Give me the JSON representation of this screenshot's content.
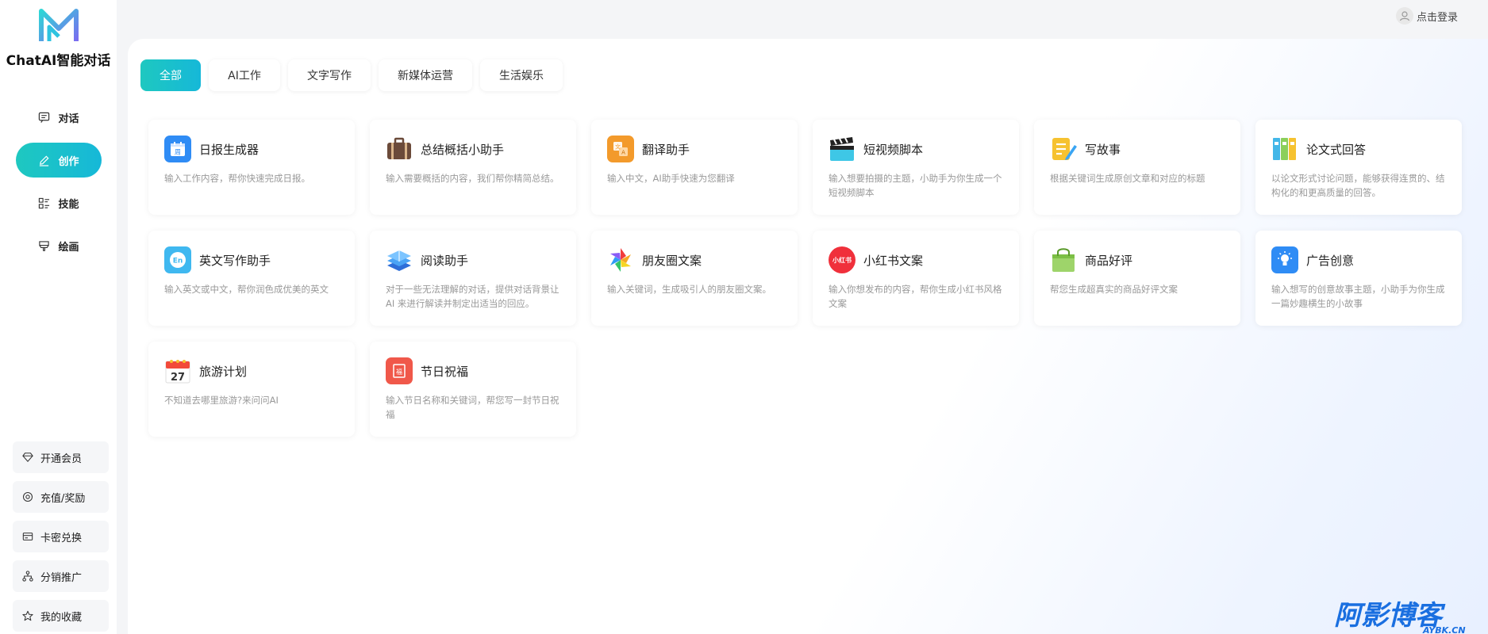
{
  "app": {
    "title": "ChatAI智能对话"
  },
  "nav": [
    {
      "label": "对话",
      "icon": "chat-icon",
      "active": false
    },
    {
      "label": "创作",
      "icon": "pen-icon",
      "active": true
    },
    {
      "label": "技能",
      "icon": "grid-list-icon",
      "active": false
    },
    {
      "label": "绘画",
      "icon": "brush-icon",
      "active": false
    }
  ],
  "bottom_menu": [
    {
      "label": "开通会员",
      "icon": "diamond-icon"
    },
    {
      "label": "充值/奖励",
      "icon": "coin-icon"
    },
    {
      "label": "卡密兑换",
      "icon": "card-icon"
    },
    {
      "label": "分销推广",
      "icon": "share-tree-icon"
    },
    {
      "label": "我的收藏",
      "icon": "star-icon"
    }
  ],
  "header": {
    "login_label": "点击登录"
  },
  "tabs": [
    "全部",
    "AI工作",
    "文字写作",
    "新媒体运营",
    "生活娱乐"
  ],
  "cards": [
    {
      "title": "日报生成器",
      "desc": "输入工作内容，帮你快速完成日报。",
      "icon": "calendar-week-icon"
    },
    {
      "title": "总结概括小助手",
      "desc": "输入需要概括的内容，我们帮你精简总结。",
      "icon": "briefcase-icon"
    },
    {
      "title": "翻译助手",
      "desc": "输入中文，AI助手快速为您翻译",
      "icon": "translate-icon"
    },
    {
      "title": "短视频脚本",
      "desc": "输入想要拍摄的主题，小助手为你生成一个短视频脚本",
      "icon": "clapperboard-icon"
    },
    {
      "title": "写故事",
      "desc": "根据关键词生成原创文章和对应的标题",
      "icon": "notepad-pencil-icon"
    },
    {
      "title": "论文式回答",
      "desc": "以论文形式讨论问题，能够获得连贯的、结构化的和更高质量的回答。",
      "icon": "binders-icon"
    },
    {
      "title": "英文写作助手",
      "desc": "输入英文或中文，帮你润色成优美的英文",
      "icon": "english-badge-icon"
    },
    {
      "title": "阅读助手",
      "desc": "对于一些无法理解的对话，提供对话背景让 AI 来进行解读并制定出适当的回应。",
      "icon": "books-icon"
    },
    {
      "title": "朋友圈文案",
      "desc": "输入关键词，生成吸引人的朋友圈文案。",
      "icon": "aperture-icon"
    },
    {
      "title": "小红书文案",
      "desc": "输入你想发布的内容，帮你生成小红书风格文案",
      "icon": "xiaohongshu-icon"
    },
    {
      "title": "商品好评",
      "desc": "帮您生成超真实的商品好评文案",
      "icon": "shopping-bag-icon"
    },
    {
      "title": "广告创意",
      "desc": "输入想写的创意故事主题，小助手为你生成一篇妙趣横生的小故事",
      "icon": "lightbulb-icon"
    },
    {
      "title": "旅游计划",
      "desc": "不知道去哪里旅游?来问问AI",
      "icon": "calendar-27-icon",
      "icon_text": "27"
    },
    {
      "title": "节日祝福",
      "desc": "输入节日名称和关键词，帮您写一封节日祝福",
      "icon": "festival-icon",
      "icon_text": "福"
    }
  ],
  "icon_texts": {
    "daily": "周",
    "xhs": "小红书",
    "lang": "En"
  },
  "watermark": {
    "text": "阿影博客",
    "sub": "AYBK.CN"
  },
  "colors": {
    "accent": "#1ec8c0",
    "accent2": "#16b8d8"
  }
}
